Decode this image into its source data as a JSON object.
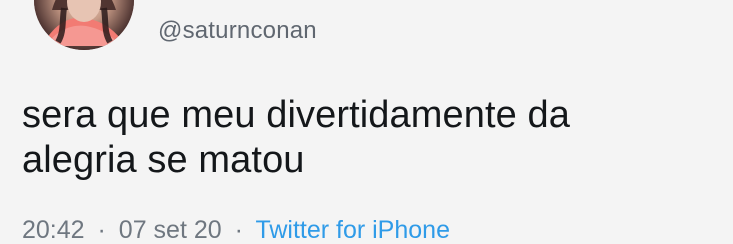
{
  "tweet": {
    "handle": "@saturnconan",
    "text_lines": [
      "sera que meu divertidamente da",
      "alegria se matou"
    ],
    "time": "20:42",
    "separator": "·",
    "date": "07 set 20",
    "source": "Twitter for iPhone"
  },
  "colors": {
    "handle": "#606770",
    "text": "#14171a",
    "meta": "#6f7780",
    "source": "#2f9be8",
    "background": "#f4f4f4"
  }
}
